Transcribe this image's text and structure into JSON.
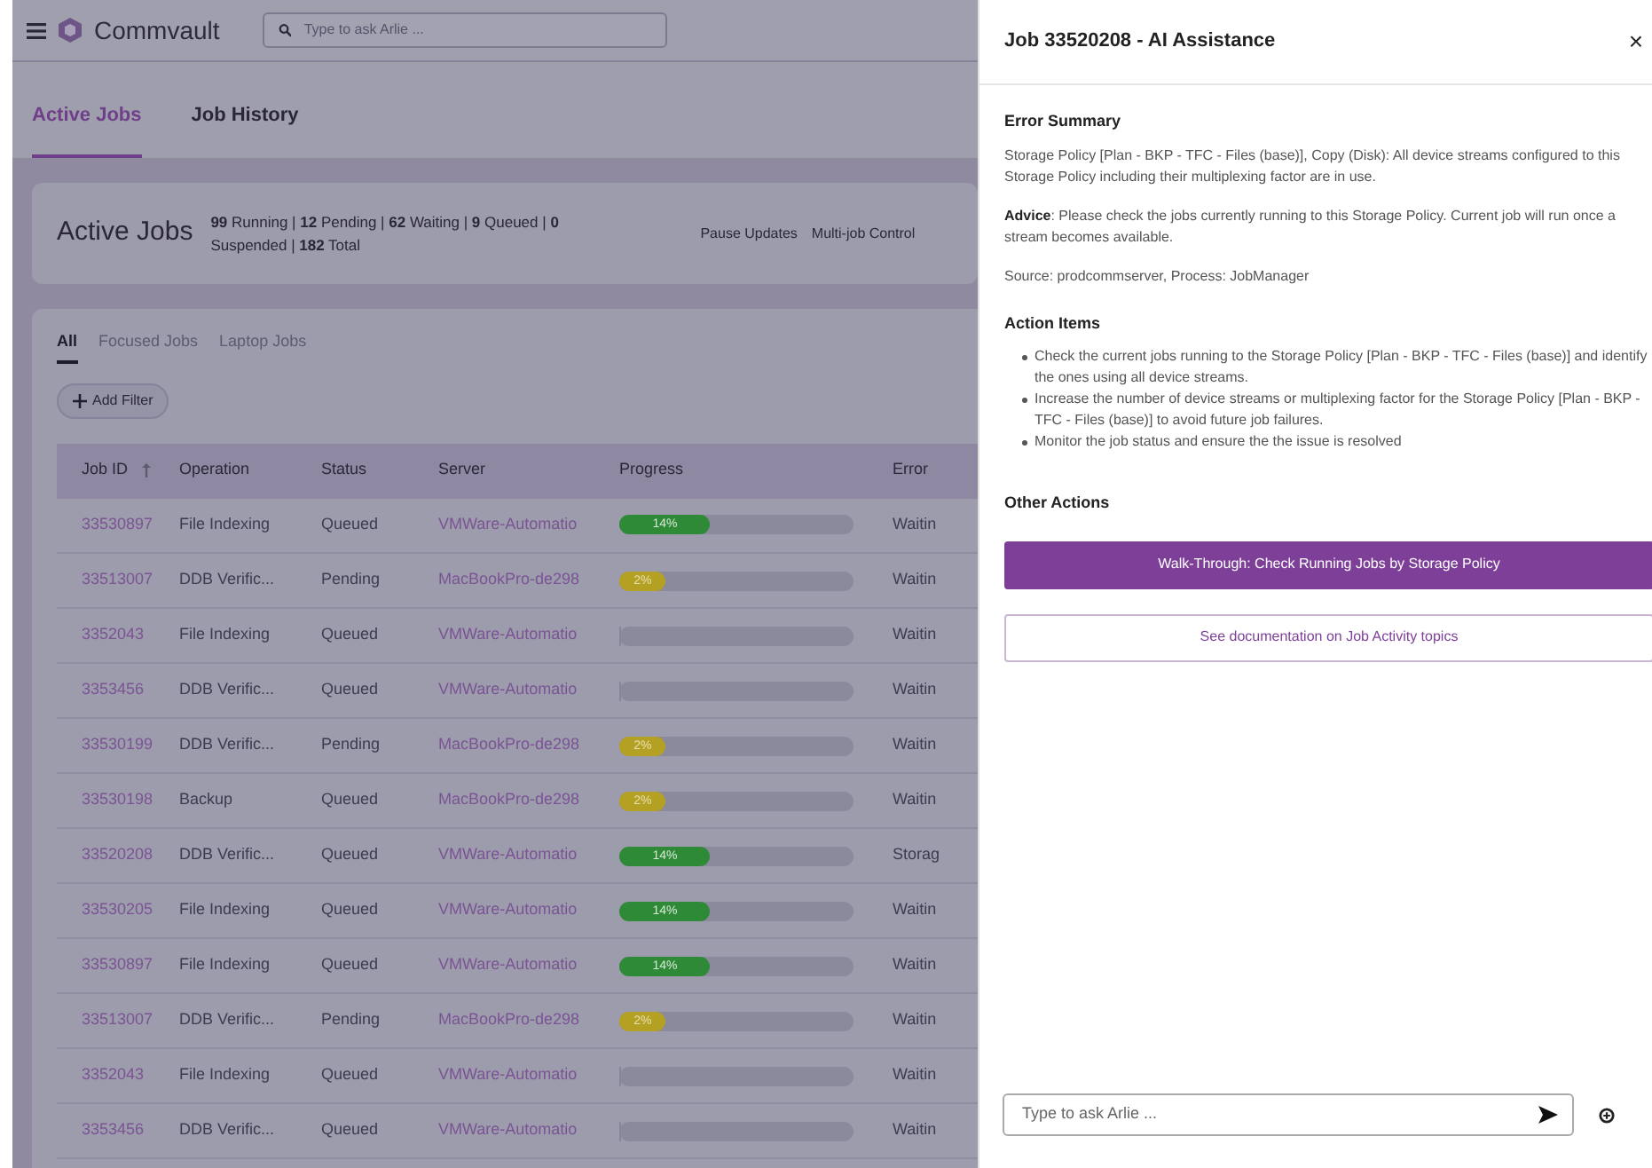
{
  "topbar": {
    "brand": "Commvault",
    "search": {
      "placeholder": "Type to ask Arlie ..."
    }
  },
  "tabs": [
    {
      "label": "Active Jobs",
      "selected": true
    },
    {
      "label": "Job History",
      "selected": false
    }
  ],
  "summary": {
    "title": "Active Jobs",
    "stats": "**99** Running | **12** Pending | **62** Waiting | **9** Queued | **0** Suspended | **182** Total",
    "actions": [
      "Pause Updates",
      "Multi-job Control"
    ]
  },
  "subtabs": [
    {
      "label": "All",
      "selected": true
    },
    {
      "label": "Focused Jobs",
      "selected": false
    },
    {
      "label": "Laptop Jobs",
      "selected": false
    }
  ],
  "add_filter": "Add Filter",
  "table": {
    "columns": [
      "Job ID",
      "Operation",
      "Status",
      "Server",
      "Progress",
      "Error"
    ],
    "rows": [
      {
        "job_id": "33530897",
        "operation": "File Indexing",
        "status": "Queued",
        "server": "VMWare-Automatio",
        "progress": {
          "kind": "ok",
          "level": 0.39,
          "reading": "14%"
        },
        "error": "Waitin"
      },
      {
        "job_id": "33513007",
        "operation": "DDB Verific...",
        "status": "Pending",
        "server": "MacBookPro-de298",
        "progress": {
          "kind": "warn",
          "level": 0.2,
          "reading": "2%"
        },
        "error": "Waitin"
      },
      {
        "job_id": "3352043",
        "operation": "File Indexing",
        "status": "Queued",
        "server": "VMWare-Automatio",
        "progress": {
          "kind": "none",
          "level": 0
        },
        "error": "Waitin"
      },
      {
        "job_id": "3353456",
        "operation": "DDB Verific...",
        "status": "Queued",
        "server": "VMWare-Automatio",
        "progress": {
          "kind": "none",
          "level": 0
        },
        "error": "Waitin"
      },
      {
        "job_id": "33530199",
        "operation": "DDB Verific...",
        "status": "Pending",
        "server": "MacBookPro-de298",
        "progress": {
          "kind": "warn",
          "level": 0.2,
          "reading": "2%"
        },
        "error": "Waitin"
      },
      {
        "job_id": "33530198",
        "operation": "Backup",
        "status": "Queued",
        "server": "MacBookPro-de298",
        "progress": {
          "kind": "warn",
          "level": 0.2,
          "reading": "2%"
        },
        "error": "Waitin"
      },
      {
        "job_id": "33520208",
        "operation": "DDB Verific...",
        "status": "Queued",
        "server": "VMWare-Automatio",
        "progress": {
          "kind": "ok",
          "level": 0.39,
          "reading": "14%"
        },
        "error": "Storag"
      },
      {
        "job_id": "33530205",
        "operation": "File Indexing",
        "status": "Queued",
        "server": "VMWare-Automatio",
        "progress": {
          "kind": "ok",
          "level": 0.39,
          "reading": "14%"
        },
        "error": "Waitin"
      },
      {
        "job_id": "33530897",
        "operation": "File Indexing",
        "status": "Queued",
        "server": "VMWare-Automatio",
        "progress": {
          "kind": "ok",
          "level": 0.39,
          "reading": "14%"
        },
        "error": "Waitin"
      },
      {
        "job_id": "33513007",
        "operation": "DDB Verific...",
        "status": "Pending",
        "server": "MacBookPro-de298",
        "progress": {
          "kind": "warn",
          "level": 0.2,
          "reading": "2%"
        },
        "error": "Waitin"
      },
      {
        "job_id": "3352043",
        "operation": "File Indexing",
        "status": "Queued",
        "server": "VMWare-Automatio",
        "progress": {
          "kind": "none",
          "level": 0
        },
        "error": "Waitin"
      },
      {
        "job_id": "3353456",
        "operation": "DDB Verific...",
        "status": "Queued",
        "server": "VMWare-Automatio",
        "progress": {
          "kind": "none",
          "level": 0
        },
        "error": "Waitin"
      }
    ]
  },
  "panel": {
    "title": "Job 33520208 - AI Assistance",
    "close": "×",
    "error_summary": {
      "heading": "Error Summary",
      "paragraphs": [
        "Storage Policy [Plan - BKP - TFC - Files (base)], Copy (Disk): All device streams configured to this Storage Policy including their multiplexing factor are in use.",
        "**Advice**: Please check the jobs currently running to this Storage Policy. Current job will run once a stream becomes available.",
        "Source: prodcommserver, Process: JobManager"
      ]
    },
    "action_items": {
      "heading": "Action Items",
      "items": [
        "Check the current jobs running to the Storage Policy [Plan - BKP - TFC - Files (base)] and identify the ones using all device streams.",
        "Increase the number of device streams or multiplexing factor for the Storage Policy [Plan - BKP - TFC - Files (base)] to avoid future job failures.",
        "Monitor the job status and ensure the the issue is resolved"
      ]
    },
    "other_actions": {
      "heading": "Other Actions",
      "buttons": [
        {
          "kind": "primary",
          "label": "Walk-Through: Check Running Jobs by Storage Policy"
        },
        {
          "kind": "outline",
          "label": "See documentation on Job Activity topics"
        }
      ]
    },
    "chat": {
      "placeholder": "Type to ask Arlie ..."
    }
  }
}
